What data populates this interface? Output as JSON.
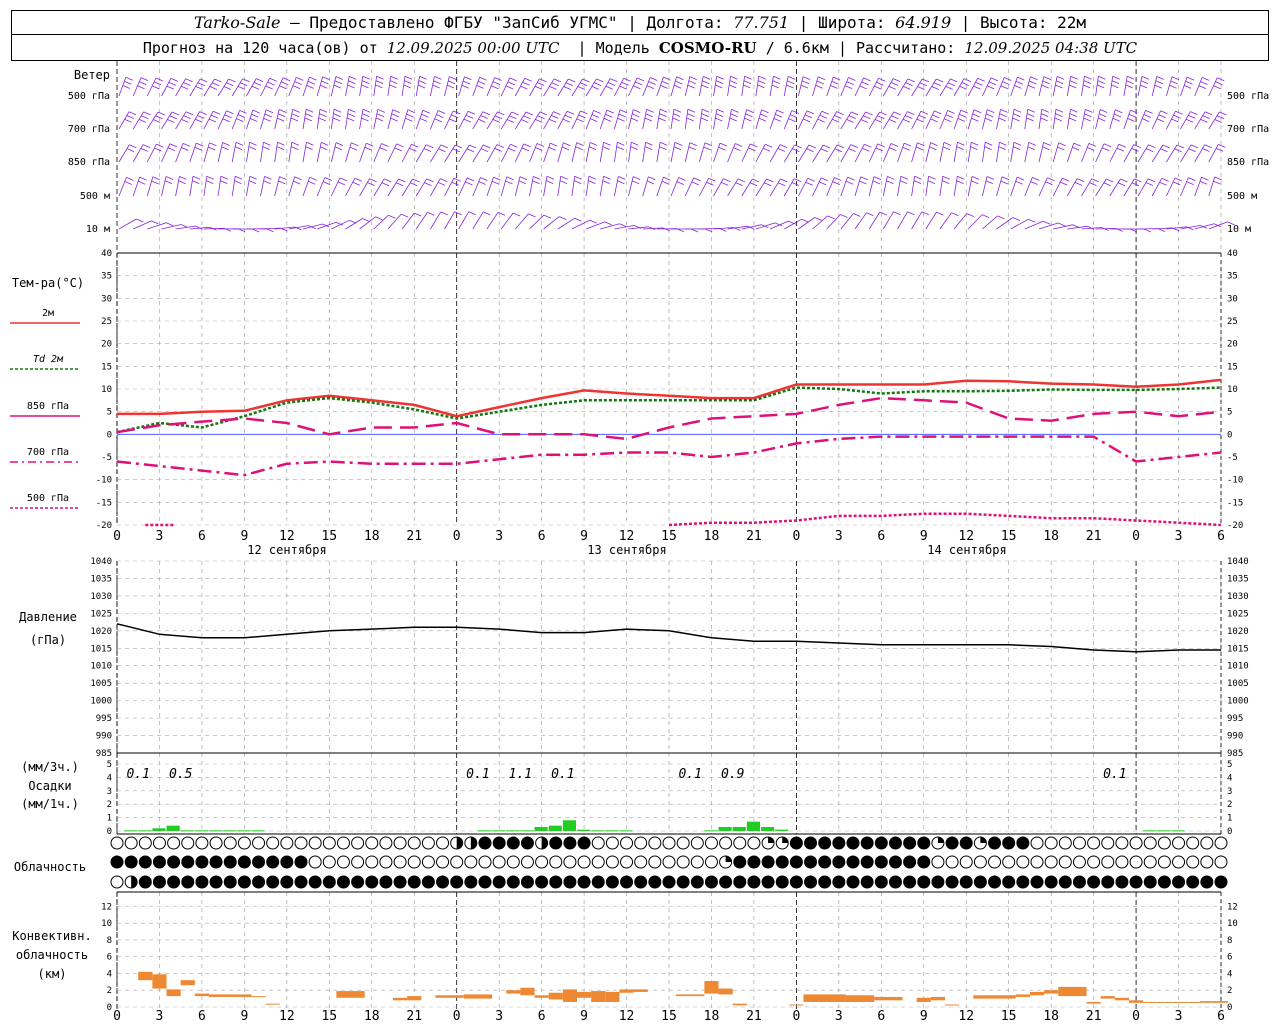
{
  "header": {
    "station": "Tarko-Sale",
    "provider": "– Предоставлено ФГБУ \"ЗапСиб УГМС\"",
    "lon_label": "| Долгота:",
    "lon": "77.751",
    "lat_label": "| Широта:",
    "lat": "64.919",
    "alt_label": "| Высота:",
    "alt": "22м",
    "forecast_label": "Прогноз на 120 часа(ов) от",
    "forecast_from": "12.09.2025 00:00 UTC",
    "model_label": "| Модель",
    "model": "COSMO-RU",
    "model_res": "/ 6.6км",
    "calc_label": "| Рассчитано:",
    "calc_time": "12.09.2025 04:38 UTC"
  },
  "labels": {
    "wind_title": "Ветер",
    "wind_levels": [
      "500 гПа",
      "700 гПа",
      "850 гПа",
      "500 м",
      "10 м"
    ],
    "temp_title": "Тем-ра(°С)",
    "legend": [
      "2м",
      "Td 2м",
      "850 гПа",
      "700 гПа",
      "500 гПа"
    ],
    "pressure_title": "Давление",
    "pressure_unit": "(гПа)",
    "precip_unit3": "(мм/3ч.)",
    "precip_title": "Осадки",
    "precip_unit1": "(мм/1ч.)",
    "cloud_title": "Облачность",
    "conv_title": "Конвективн.",
    "conv_title2": "облачность",
    "conv_unit": "(км)",
    "dates": [
      "12 сентября",
      "13 сентября",
      "14 сентября"
    ],
    "hour_ticks": [
      "0",
      "3",
      "6",
      "9",
      "12",
      "15",
      "18",
      "21",
      "0",
      "3",
      "6",
      "9",
      "12",
      "15",
      "18",
      "21",
      "0",
      "3",
      "6",
      "9",
      "12",
      "15",
      "18",
      "21",
      "0",
      "3",
      "6"
    ]
  },
  "colors": {
    "t2m": "#ee3333",
    "td2m": "#117711",
    "t850": "#dd1177",
    "t700": "#dd1177",
    "t500": "#dd1177",
    "wind": "#8822dd",
    "precip": "#22cc22",
    "conv": "#ee8833",
    "pressure": "#000000"
  },
  "chart_data": [
    {
      "type": "line",
      "title": "Тем-ра(°С)",
      "x_hours": [
        0,
        3,
        6,
        9,
        12,
        15,
        18,
        21,
        24,
        27,
        30,
        33,
        36,
        39,
        42,
        45,
        48,
        51,
        54,
        57,
        60,
        63,
        66,
        69,
        72,
        75,
        78
      ],
      "ylim": [
        -20,
        40
      ],
      "yticks": [
        -20,
        -15,
        -10,
        -5,
        0,
        5,
        10,
        15,
        20,
        25,
        30,
        35,
        40
      ],
      "series": [
        {
          "name": "2м",
          "values": [
            4.5,
            4.5,
            5.0,
            5.2,
            7.5,
            8.5,
            7.5,
            6.5,
            4.0,
            6.0,
            8.0,
            9.7,
            9.0,
            8.5,
            8.0,
            8.0,
            11.0,
            11.0,
            11.0,
            11.0,
            11.8,
            11.7,
            11.2,
            11.0,
            10.5,
            11.0,
            12.0
          ]
        },
        {
          "name": "Td 2м",
          "values": [
            0.5,
            2.5,
            1.5,
            4.0,
            7.0,
            8.0,
            7.0,
            5.5,
            3.5,
            5.0,
            6.5,
            7.5,
            7.5,
            7.5,
            7.5,
            7.5,
            10.3,
            10.0,
            9.0,
            9.5,
            9.5,
            9.6,
            9.9,
            9.8,
            9.8,
            10.0,
            10.3
          ]
        },
        {
          "name": "850 гПа",
          "values": [
            0.5,
            2.0,
            2.8,
            3.5,
            2.5,
            0.0,
            1.5,
            1.5,
            2.5,
            0.0,
            0.0,
            0.0,
            -1.0,
            1.5,
            3.5,
            4.0,
            4.5,
            6.5,
            8.0,
            7.5,
            7.0,
            3.5,
            3.0,
            4.5,
            5.0,
            4.0,
            5.0
          ]
        },
        {
          "name": "700 гПа",
          "values": [
            -6.0,
            -7.0,
            -8.0,
            -9.0,
            -6.5,
            -6.0,
            -6.5,
            -6.5,
            -6.5,
            -5.5,
            -4.5,
            -4.5,
            -4.0,
            -4.0,
            -5.0,
            -4.0,
            -2.0,
            -1.0,
            -0.5,
            -0.5,
            -0.5,
            -0.5,
            -0.5,
            -0.5,
            -6.0,
            -5.0,
            -4.0
          ]
        },
        {
          "name": "500 гПа",
          "values": [
            null,
            -20.0,
            null,
            null,
            null,
            null,
            null,
            null,
            null,
            null,
            null,
            null,
            null,
            -20.0,
            -19.5,
            -19.5,
            -19.0,
            -18.0,
            -18.0,
            -17.5,
            -17.5,
            -18.0,
            -18.5,
            -18.5,
            -19.0,
            -19.5,
            -20.0
          ]
        }
      ]
    },
    {
      "type": "line",
      "title": "Давление",
      "ylabel": "(гПа)",
      "x_hours": [
        0,
        3,
        6,
        9,
        12,
        15,
        18,
        21,
        24,
        27,
        30,
        33,
        36,
        39,
        42,
        45,
        48,
        51,
        54,
        57,
        60,
        63,
        66,
        69,
        72,
        75,
        78
      ],
      "ylim": [
        985,
        1040
      ],
      "yticks": [
        985,
        990,
        995,
        1000,
        1005,
        1010,
        1015,
        1020,
        1025,
        1030,
        1035,
        1040
      ],
      "values": [
        1022,
        1019,
        1018,
        1018,
        1019,
        1020,
        1020.5,
        1021,
        1021,
        1020.5,
        1019.5,
        1019.5,
        1020.5,
        1020,
        1018,
        1017,
        1017,
        1016.5,
        1016,
        1016,
        1016,
        1016,
        1015.5,
        1014.5,
        1014,
        1014.5,
        1014.5
      ]
    },
    {
      "type": "bar",
      "title": "Осадки",
      "x_hours": [
        1,
        2,
        3,
        4,
        5,
        6,
        7,
        8,
        9,
        10,
        26,
        27,
        28,
        29,
        30,
        31,
        32,
        33,
        34,
        35,
        36,
        42,
        43,
        44,
        45,
        46,
        47,
        73,
        74,
        75
      ],
      "values": [
        0.05,
        0.05,
        0.2,
        0.4,
        0.05,
        0.05,
        0.05,
        0.05,
        0.05,
        0.05,
        0.05,
        0.05,
        0.05,
        0.05,
        0.3,
        0.4,
        0.8,
        0.1,
        0.05,
        0.05,
        0.05,
        0.05,
        0.3,
        0.3,
        0.7,
        0.3,
        0.1,
        0.05,
        0.05,
        0.05
      ],
      "ylim": [
        0,
        5
      ],
      "yticks": [
        0,
        1,
        2,
        3,
        4,
        5
      ],
      "labels_3h": [
        {
          "hour": 1.5,
          "text": "0.1"
        },
        {
          "hour": 4.5,
          "text": "0.5"
        },
        {
          "hour": 25.5,
          "text": "0.1"
        },
        {
          "hour": 28.5,
          "text": "1.1"
        },
        {
          "hour": 31.5,
          "text": "0.1"
        },
        {
          "hour": 40.5,
          "text": "0.1"
        },
        {
          "hour": 43.5,
          "text": "0.9"
        },
        {
          "hour": 70.5,
          "text": "0.1"
        }
      ]
    },
    {
      "type": "bar",
      "title": "Конвективн. облачность",
      "ylabel": "(км)",
      "ylim": [
        0,
        14
      ],
      "yticks": [
        0,
        2,
        4,
        6,
        8,
        10,
        12
      ],
      "bars": [
        {
          "x0": 1.5,
          "x1": 2.5,
          "lo": 3.2,
          "hi": 4.2
        },
        {
          "x0": 2.5,
          "x1": 3.5,
          "lo": 2.2,
          "hi": 3.9
        },
        {
          "x0": 3.5,
          "x1": 4.5,
          "lo": 1.3,
          "hi": 2.1
        },
        {
          "x0": 4.5,
          "x1": 5.5,
          "lo": 2.6,
          "hi": 3.2
        },
        {
          "x0": 5.5,
          "x1": 6.5,
          "lo": 1.3,
          "hi": 1.6
        },
        {
          "x0": 6.5,
          "x1": 9.5,
          "lo": 1.2,
          "hi": 1.5
        },
        {
          "x0": 9.5,
          "x1": 10.5,
          "lo": 1.2,
          "hi": 1.3
        },
        {
          "x0": 10.5,
          "x1": 11.5,
          "lo": 0.3,
          "hi": 0.4
        },
        {
          "x0": 15.5,
          "x1": 17.5,
          "lo": 1.1,
          "hi": 1.9
        },
        {
          "x0": 19.5,
          "x1": 20.5,
          "lo": 0.8,
          "hi": 1.1
        },
        {
          "x0": 20.5,
          "x1": 21.5,
          "lo": 0.8,
          "hi": 1.3
        },
        {
          "x0": 22.5,
          "x1": 24.5,
          "lo": 1.1,
          "hi": 1.4
        },
        {
          "x0": 24.5,
          "x1": 26.5,
          "lo": 1.0,
          "hi": 1.5
        },
        {
          "x0": 27.5,
          "x1": 28.5,
          "lo": 1.6,
          "hi": 2.0
        },
        {
          "x0": 28.5,
          "x1": 29.5,
          "lo": 1.4,
          "hi": 2.3
        },
        {
          "x0": 29.5,
          "x1": 30.5,
          "lo": 1.1,
          "hi": 1.4
        },
        {
          "x0": 30.5,
          "x1": 31.5,
          "lo": 0.9,
          "hi": 1.7
        },
        {
          "x0": 31.5,
          "x1": 32.5,
          "lo": 0.6,
          "hi": 2.1
        },
        {
          "x0": 32.5,
          "x1": 33.5,
          "lo": 1.1,
          "hi": 1.8
        },
        {
          "x0": 33.5,
          "x1": 34.5,
          "lo": 0.6,
          "hi": 1.9
        },
        {
          "x0": 34.5,
          "x1": 35.5,
          "lo": 0.6,
          "hi": 1.8
        },
        {
          "x0": 35.5,
          "x1": 36.5,
          "lo": 1.7,
          "hi": 2.1
        },
        {
          "x0": 36.5,
          "x1": 37.5,
          "lo": 1.8,
          "hi": 2.1
        },
        {
          "x0": 39.5,
          "x1": 41.5,
          "lo": 1.3,
          "hi": 1.5
        },
        {
          "x0": 41.5,
          "x1": 42.5,
          "lo": 1.6,
          "hi": 3.1
        },
        {
          "x0": 42.5,
          "x1": 43.5,
          "lo": 1.5,
          "hi": 2.2
        },
        {
          "x0": 43.5,
          "x1": 44.5,
          "lo": 0.2,
          "hi": 0.4
        },
        {
          "x0": 47.5,
          "x1": 48.5,
          "lo": 0.2,
          "hi": 0.3
        },
        {
          "x0": 48.5,
          "x1": 51.5,
          "lo": 0.6,
          "hi": 1.5
        },
        {
          "x0": 51.5,
          "x1": 53.5,
          "lo": 0.6,
          "hi": 1.4
        },
        {
          "x0": 53.5,
          "x1": 55.5,
          "lo": 0.8,
          "hi": 1.2
        },
        {
          "x0": 56.5,
          "x1": 57.5,
          "lo": 0.6,
          "hi": 1.1
        },
        {
          "x0": 57.5,
          "x1": 58.5,
          "lo": 0.8,
          "hi": 1.2
        },
        {
          "x0": 58.5,
          "x1": 59.5,
          "lo": 0.2,
          "hi": 0.3
        },
        {
          "x0": 60.5,
          "x1": 63.5,
          "lo": 1.0,
          "hi": 1.4
        },
        {
          "x0": 63.5,
          "x1": 64.5,
          "lo": 1.2,
          "hi": 1.5
        },
        {
          "x0": 64.5,
          "x1": 65.5,
          "lo": 1.4,
          "hi": 1.8
        },
        {
          "x0": 65.5,
          "x1": 66.5,
          "lo": 1.6,
          "hi": 2.0
        },
        {
          "x0": 66.5,
          "x1": 68.5,
          "lo": 1.3,
          "hi": 2.4
        },
        {
          "x0": 68.5,
          "x1": 69.5,
          "lo": 0.4,
          "hi": 0.6
        },
        {
          "x0": 69.5,
          "x1": 70.5,
          "lo": 1.0,
          "hi": 1.3
        },
        {
          "x0": 70.5,
          "x1": 71.5,
          "lo": 0.8,
          "hi": 1.1
        },
        {
          "x0": 71.5,
          "x1": 72.5,
          "lo": 0.5,
          "hi": 0.8
        },
        {
          "x0": 72.5,
          "x1": 76.5,
          "lo": 0.5,
          "hi": 0.6
        },
        {
          "x0": 76.5,
          "x1": 78.5,
          "lo": 0.5,
          "hi": 0.7
        }
      ]
    }
  ]
}
